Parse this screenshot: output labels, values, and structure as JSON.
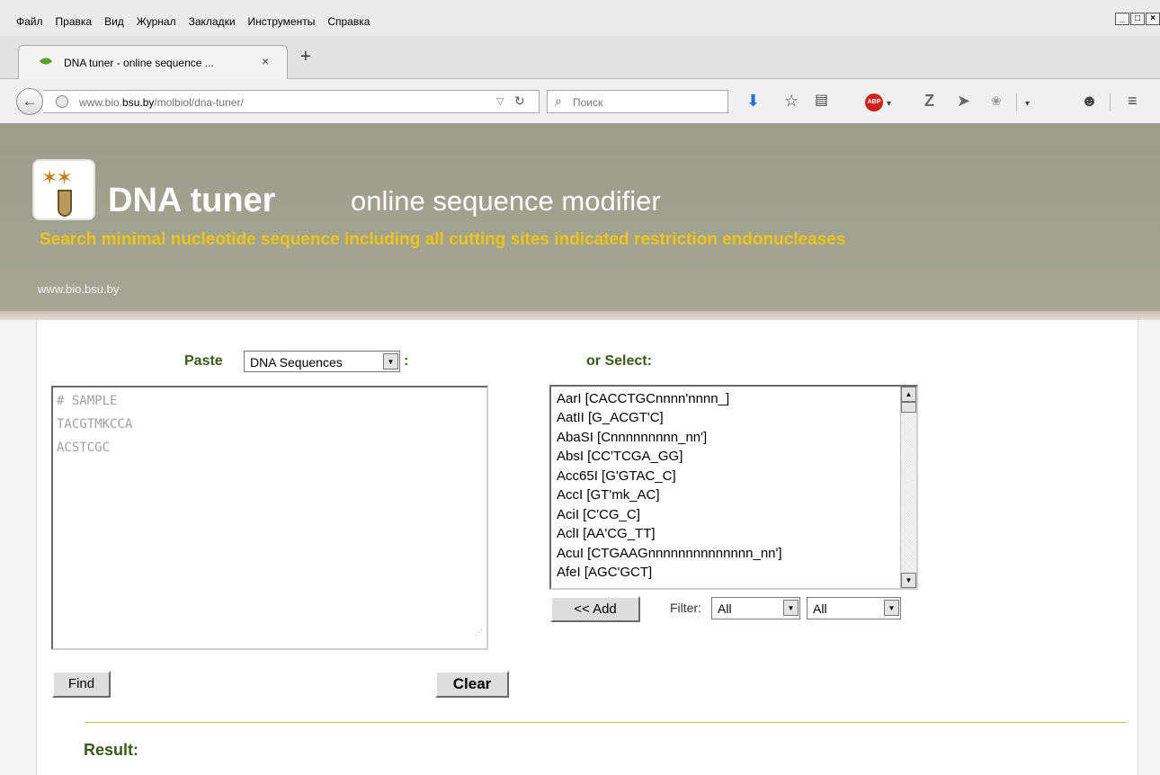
{
  "menubar": {
    "items": [
      "Файл",
      "Правка",
      "Вид",
      "Журнал",
      "Закладки",
      "Инструменты",
      "Справка"
    ],
    "window_controls": [
      "_",
      "□",
      "×"
    ]
  },
  "tab": {
    "title": "DNA tuner - online sequence ...",
    "close": "×",
    "new_tab": "+"
  },
  "navbar": {
    "url_prefix": "www.bio.",
    "url_host": "bsu.by",
    "url_path": "/molbiol/dna-tuner/",
    "search_placeholder": "Поиск",
    "abp_label": "ABP"
  },
  "header": {
    "brand": "DNA tuner",
    "tagline": "online sequence modifier",
    "subtitle": "Search minimal nucleotide sequence including all cutting sites indicated restriction endonucleases",
    "site": "www.bio.bsu.by"
  },
  "form": {
    "paste_label": "Paste",
    "input_type": "DNA Sequences",
    "colon": ":",
    "textarea_lines": [
      "# SAMPLE",
      "TACGTMKCCA",
      "ACSTCGC"
    ],
    "find_label": "Find",
    "clear_label": "Clear"
  },
  "selector": {
    "label": "or Select:",
    "enzymes": [
      "AarI [CACCTGCnnnn'nnnn_]",
      "AatII [G_ACGT'C]",
      "AbaSI [Cnnnnnnnnn_nn']",
      "AbsI [CC'TCGA_GG]",
      "Acc65I [G'GTAC_C]",
      "AccI [GT'mk_AC]",
      "AciI [C'CG_C]",
      "AclI [AA'CG_TT]",
      "AcuI [CTGAAGnnnnnnnnnnnnnn_nn']",
      "AfeI [AGC'GCT]"
    ],
    "add_label": "<< Add",
    "filter_label": "Filter:",
    "filter1": "All",
    "filter2": "All"
  },
  "result": {
    "label": "Result:"
  }
}
